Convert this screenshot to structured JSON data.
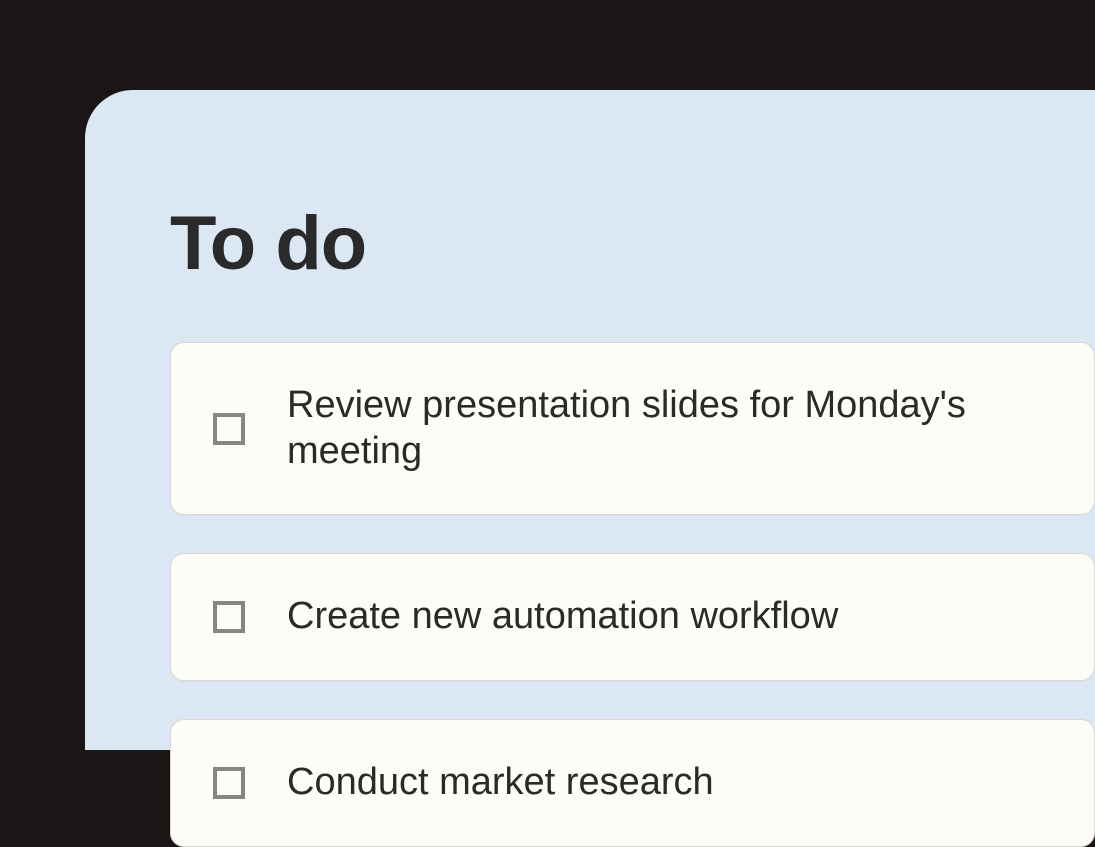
{
  "header": {
    "title": "To do"
  },
  "tasks": [
    {
      "label": "Review presentation slides for Monday's meeting",
      "checked": false
    },
    {
      "label": "Create new automation workflow",
      "checked": false
    },
    {
      "label": "Conduct market research",
      "checked": false
    }
  ],
  "colors": {
    "background": "#1c1515",
    "panel": "#dce7f4",
    "card": "#fdfcf6",
    "text": "#2a2a2a",
    "checkbox_border": "#878780"
  }
}
